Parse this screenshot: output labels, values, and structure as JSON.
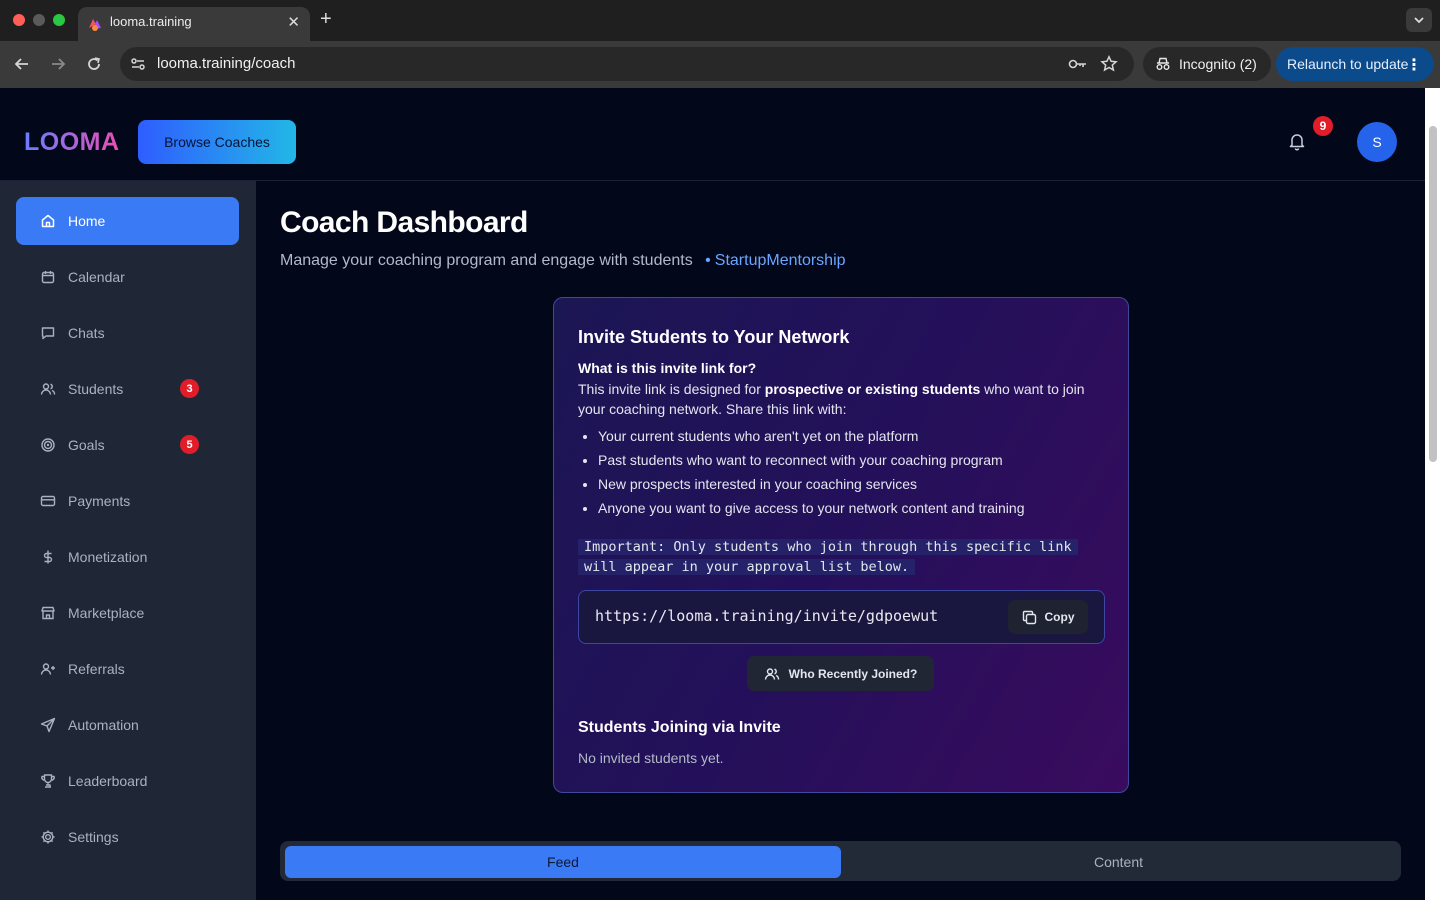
{
  "browser": {
    "tab_title": "looma.training",
    "url": "looma.training/coach",
    "incognito_label": "Incognito (2)",
    "relaunch_label": "Relaunch to update"
  },
  "header": {
    "logo": "LOOMA",
    "browse_label": "Browse Coaches",
    "notification_count": "9",
    "avatar_initial": "S"
  },
  "sidebar": {
    "items": [
      {
        "label": "Home",
        "icon": "home-icon"
      },
      {
        "label": "Calendar",
        "icon": "calendar-icon"
      },
      {
        "label": "Chats",
        "icon": "chat-icon"
      },
      {
        "label": "Students",
        "icon": "users-icon",
        "badge": "3"
      },
      {
        "label": "Goals",
        "icon": "target-icon",
        "badge": "5"
      },
      {
        "label": "Payments",
        "icon": "card-icon"
      },
      {
        "label": "Monetization",
        "icon": "dollar-icon"
      },
      {
        "label": "Marketplace",
        "icon": "store-icon"
      },
      {
        "label": "Referrals",
        "icon": "user-plus-icon"
      },
      {
        "label": "Automation",
        "icon": "send-icon"
      },
      {
        "label": "Leaderboard",
        "icon": "trophy-icon"
      },
      {
        "label": "Settings",
        "icon": "gear-icon"
      }
    ]
  },
  "main": {
    "title": "Coach Dashboard",
    "subtitle": "Manage your coaching program and engage with students",
    "program_tag": "StartupMentorship",
    "invite": {
      "title": "Invite Students to Your Network",
      "question": "What is this invite link for?",
      "desc_before": "This invite link is designed for ",
      "desc_bold": "prospective or existing students",
      "desc_after": " who want to join your coaching network. Share this link with:",
      "list": [
        "Your current students who aren't yet on the platform",
        "Past students who want to reconnect with your coaching program",
        "New prospects interested in your coaching services",
        "Anyone you want to give access to your network content and training"
      ],
      "important": "Important: Only students who join through this specific link will appear in your approval list below.",
      "link": "https://looma.training/invite/gdpoewut",
      "copy_label": "Copy",
      "recent_label": "Who Recently Joined?",
      "joining_title": "Students Joining via Invite",
      "joining_empty": "No invited students yet."
    },
    "tabs": [
      {
        "label": "Feed",
        "active": true
      },
      {
        "label": "Content",
        "active": false
      }
    ]
  },
  "colors": {
    "accent": "#3b7af5",
    "badge": "#e11d2a",
    "background": "#02081a",
    "sidebar": "#1f2737"
  }
}
